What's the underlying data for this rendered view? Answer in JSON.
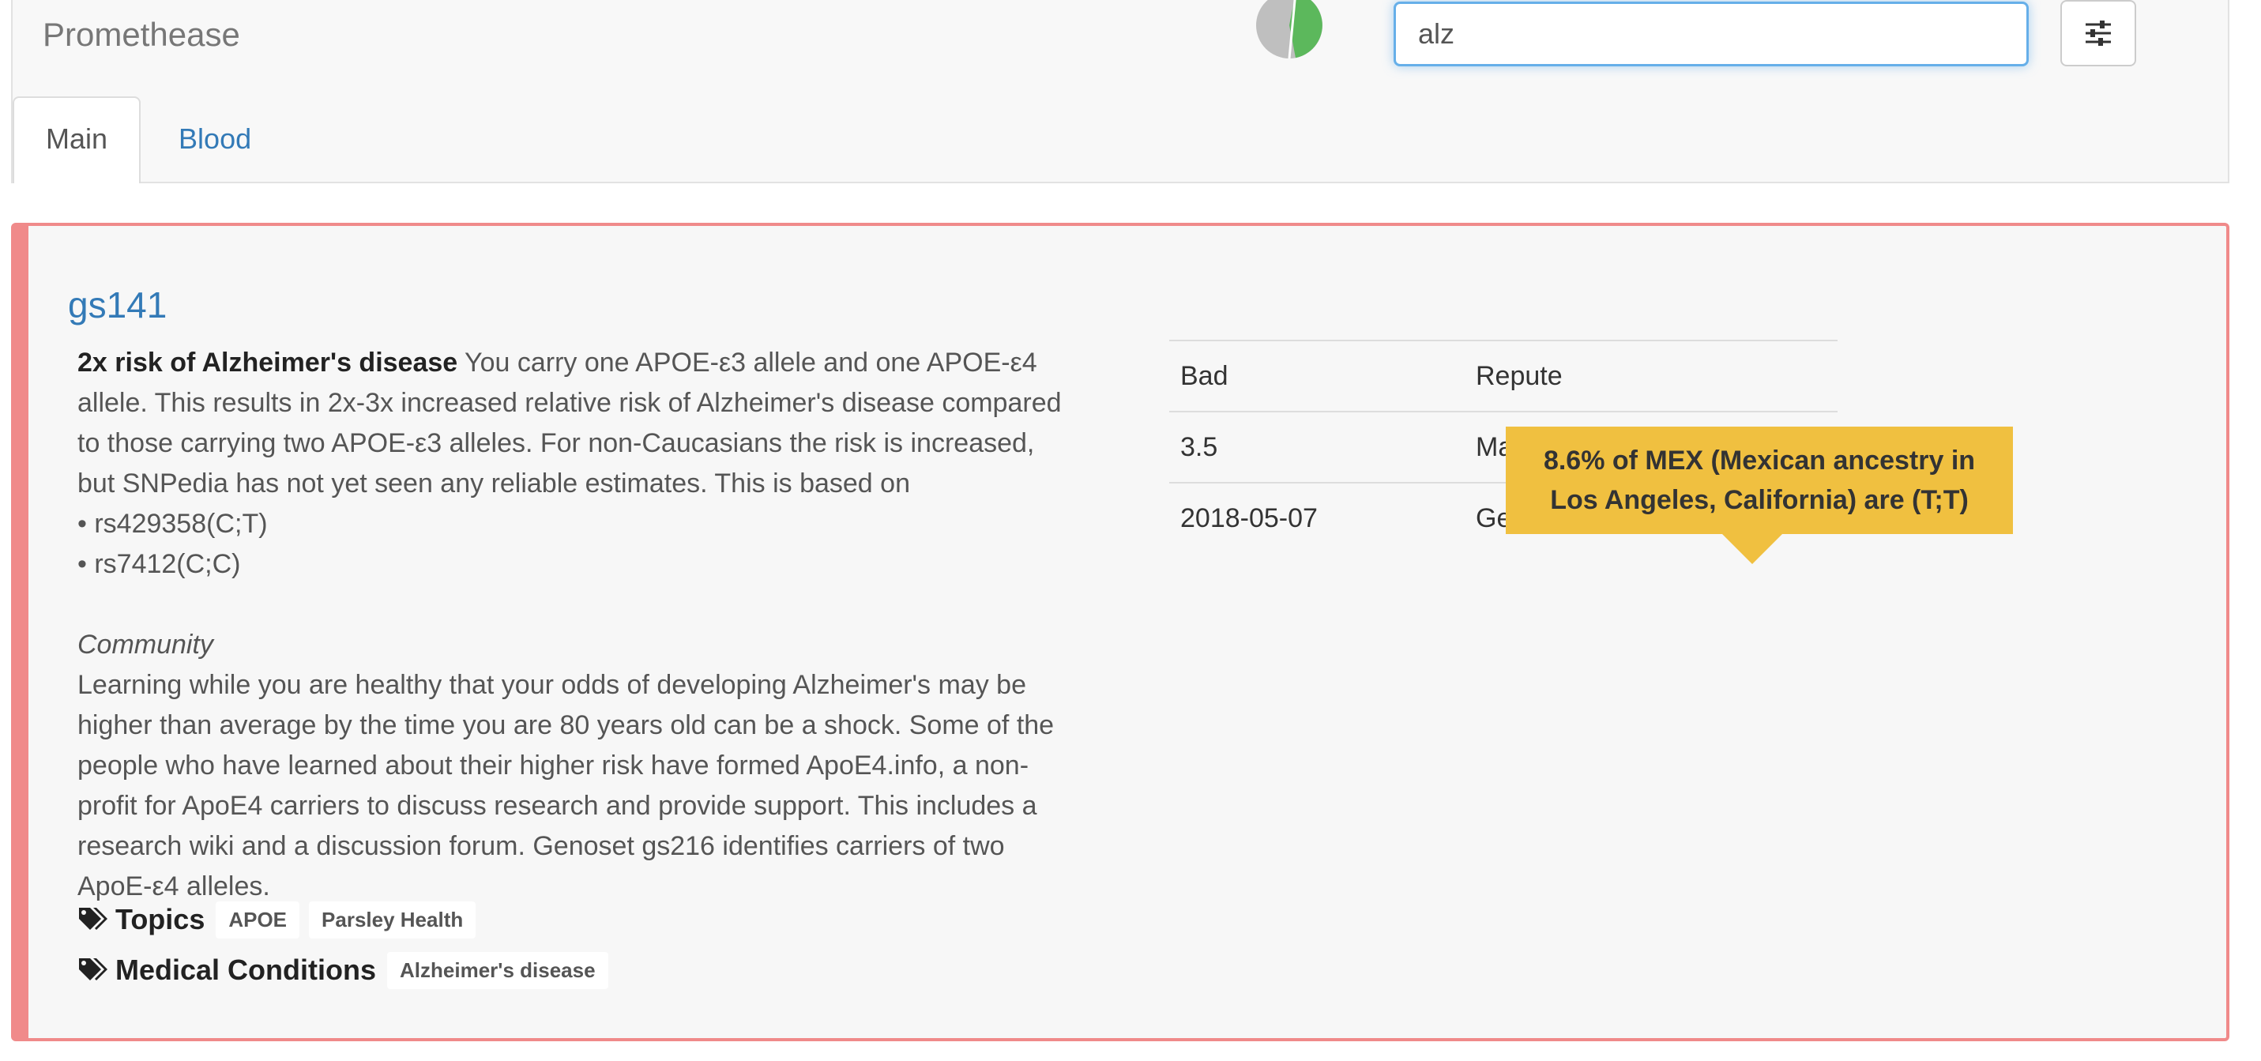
{
  "header": {
    "brand": "Promethease",
    "search": {
      "value": "alz",
      "placeholder": ""
    },
    "settings_icon": "sliders-icon",
    "pie_colors": {
      "left": "#bfbfbf",
      "right": "#5cb85c"
    }
  },
  "tabs": [
    {
      "label": "Main",
      "active": true
    },
    {
      "label": "Blood",
      "active": false
    }
  ],
  "result": {
    "title": "gs141",
    "accent_color": "#f08a8a",
    "summary_bold": "2x risk of Alzheimer's disease",
    "summary_lines": [
      "You carry one APOE-ε3 allele and one APOE-ε4",
      "allele. This results in 2x-3x increased relative risk of Alzheimer's disease compared",
      "to those carrying two APOE-ε3 alleles. For non-Caucasians the risk is increased,",
      "but SNPedia has not yet seen any reliable estimates. This is based on"
    ],
    "bullets": [
      "• rs429358(C;T)",
      "• rs7412(C;C)"
    ],
    "community_title": "Community",
    "community_lines": [
      "Learning while you are healthy that your odds of developing Alzheimer's may be",
      "higher than average by the time you are 80 years old can be a shock. Some of the",
      "people who have learned about their higher risk have formed ApoE4.info, a non-",
      "profit for ApoE4 carriers to discuss research and provide support. This includes a",
      "research wiki and a discussion forum. Genoset gs216 identifies carriers of two",
      "ApoE-ε4 alleles."
    ],
    "topics_label": "Topics",
    "topics": [
      "APOE",
      "Parsley Health"
    ],
    "conditions_label": "Medical Conditions",
    "conditions": [
      "Alzheimer's disease"
    ],
    "tag_icon": "tags-icon",
    "stats": [
      {
        "value": "Bad",
        "label": "Repute"
      },
      {
        "value": "3.5",
        "label": "Magnitude"
      },
      {
        "value": "2018-05-07",
        "label": "Geno modified"
      }
    ],
    "tooltip": {
      "line1": "8.6% of MEX (Mexican ancestry in",
      "line2": "Los Angeles, California) are (T;T)",
      "color": "#f0c040"
    }
  }
}
